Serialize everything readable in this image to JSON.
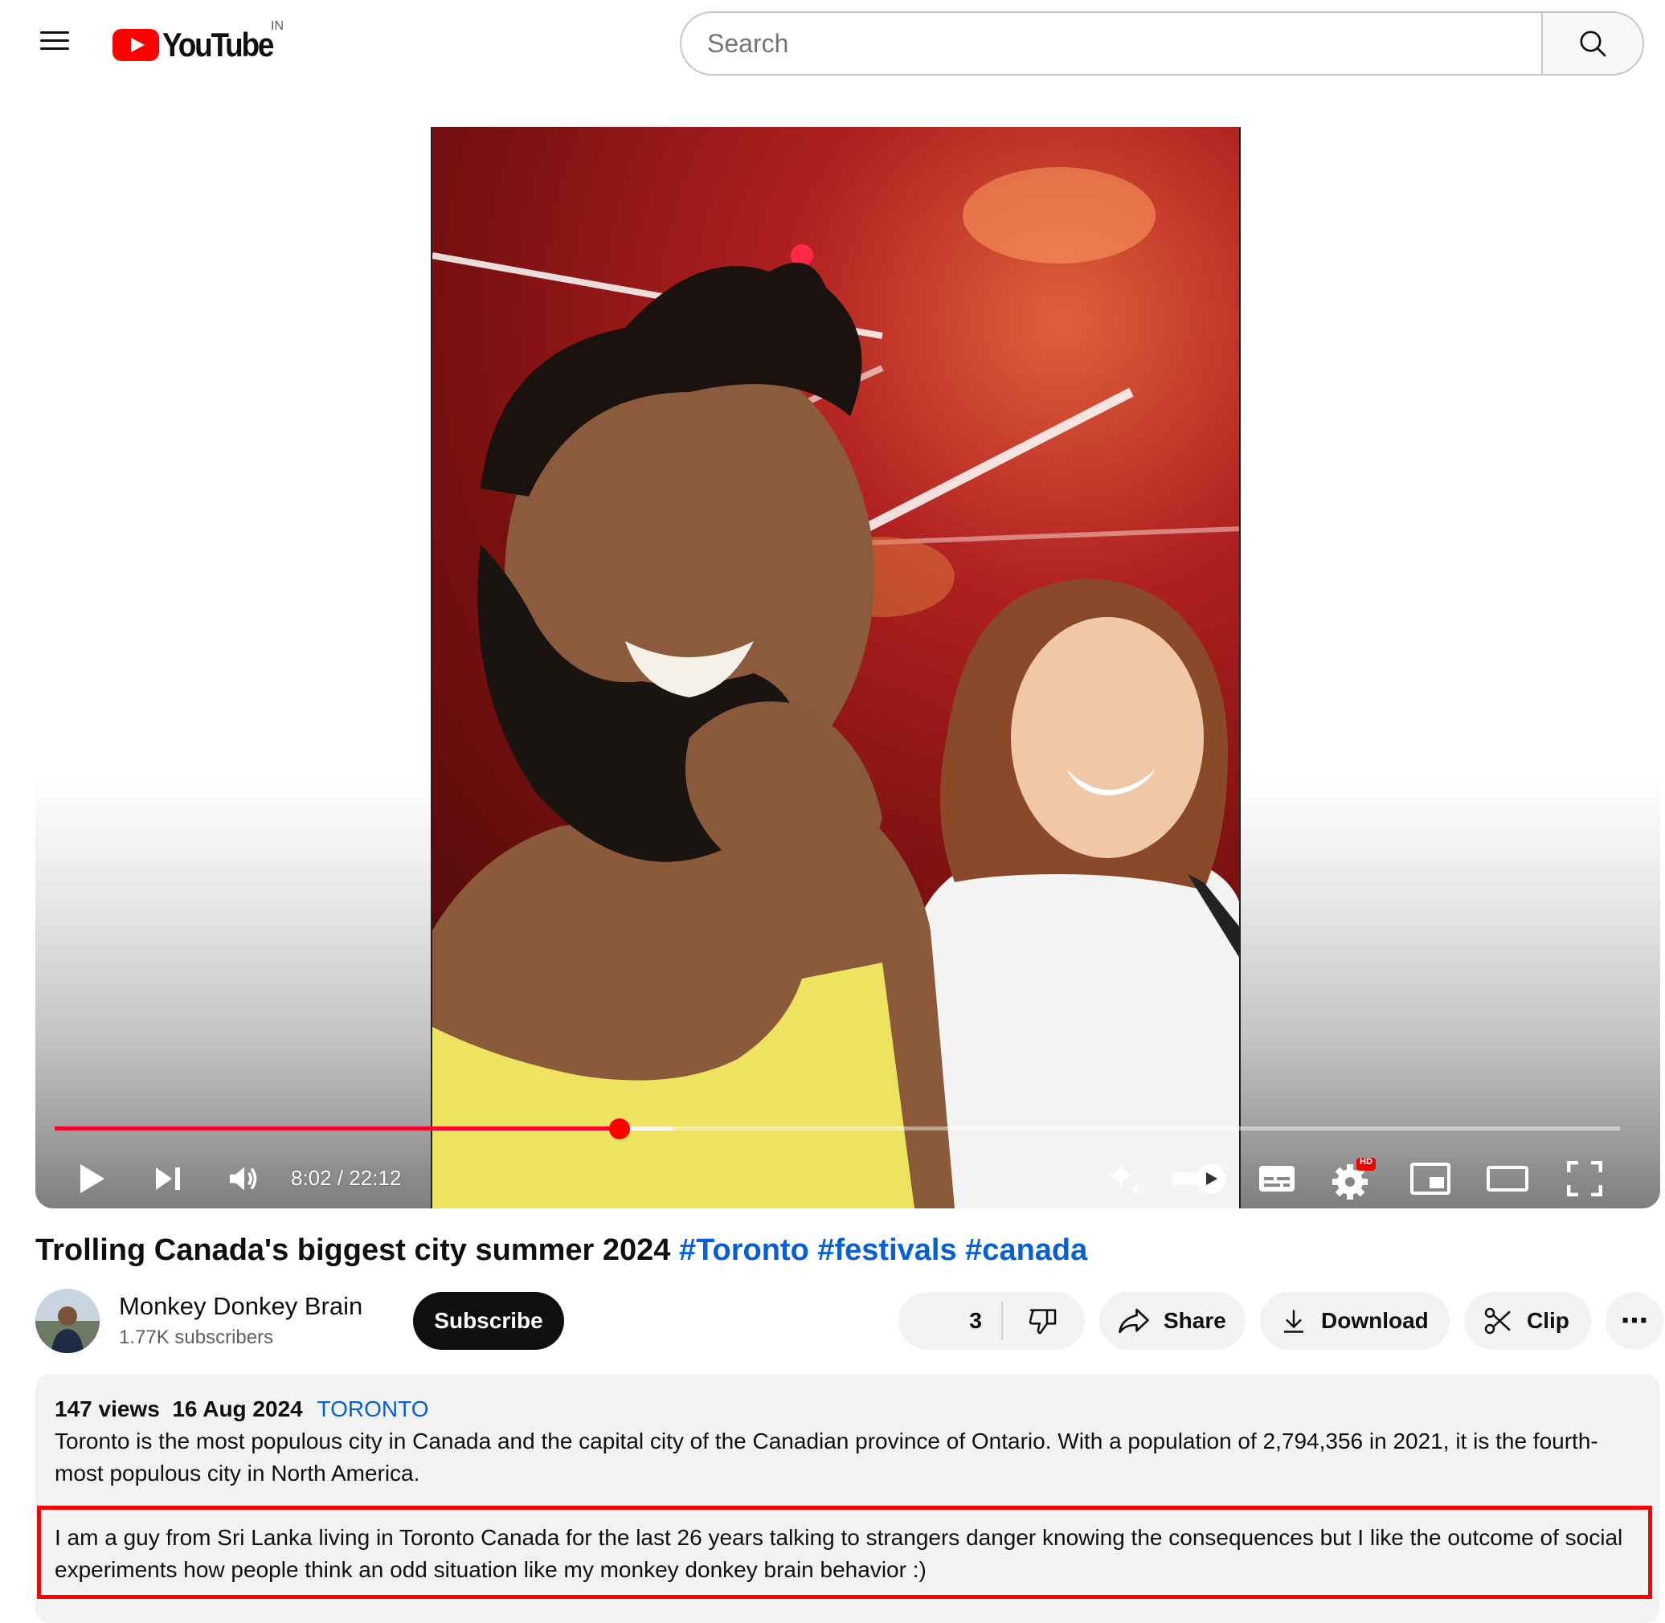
{
  "header": {
    "logo_text": "YouTube",
    "country_code": "IN",
    "search_placeholder": "Search"
  },
  "player": {
    "current_time": "8:02",
    "duration": "22:12",
    "time_display": "8:02 / 22:12",
    "progress_fraction": 0.361,
    "buffered_fraction": 0.395,
    "settings_badge": "HD",
    "accent_color": "#ff0000"
  },
  "video": {
    "title_text": "Trolling Canada's biggest city summer 2024",
    "hashtags": [
      "#Toronto",
      "#festivals",
      "#canada"
    ]
  },
  "channel": {
    "name": "Monkey Donkey Brain",
    "subscribers": "1.77K subscribers",
    "subscribe_label": "Subscribe"
  },
  "actions": {
    "like_count": "3",
    "share_label": "Share",
    "download_label": "Download",
    "clip_label": "Clip",
    "more_label": "⋯"
  },
  "description": {
    "views": "147 views",
    "date": "16 Aug 2024",
    "location": "TORONTO",
    "paragraph1": "Toronto is the most populous city in Canada and the capital city of the Canadian province of Ontario. With a population of 2,794,356 in 2021, it is the fourth-most populous city in North America.",
    "paragraph2": "I am a guy from Sri Lanka living in Toronto Canada for the last 26 years talking to strangers danger knowing the consequences but I like the outcome of social experiments how people think an odd situation  like my monkey donkey brain behavior :)"
  },
  "icons": [
    "menu-icon",
    "search-icon",
    "play-icon",
    "next-icon",
    "volume-icon",
    "sparkle-icon",
    "autoplay-toggle-icon",
    "subtitles-icon",
    "settings-gear-icon",
    "miniplayer-icon",
    "theater-icon",
    "fullscreen-icon",
    "like-icon",
    "dislike-icon",
    "share-icon",
    "download-icon",
    "scissors-icon"
  ]
}
